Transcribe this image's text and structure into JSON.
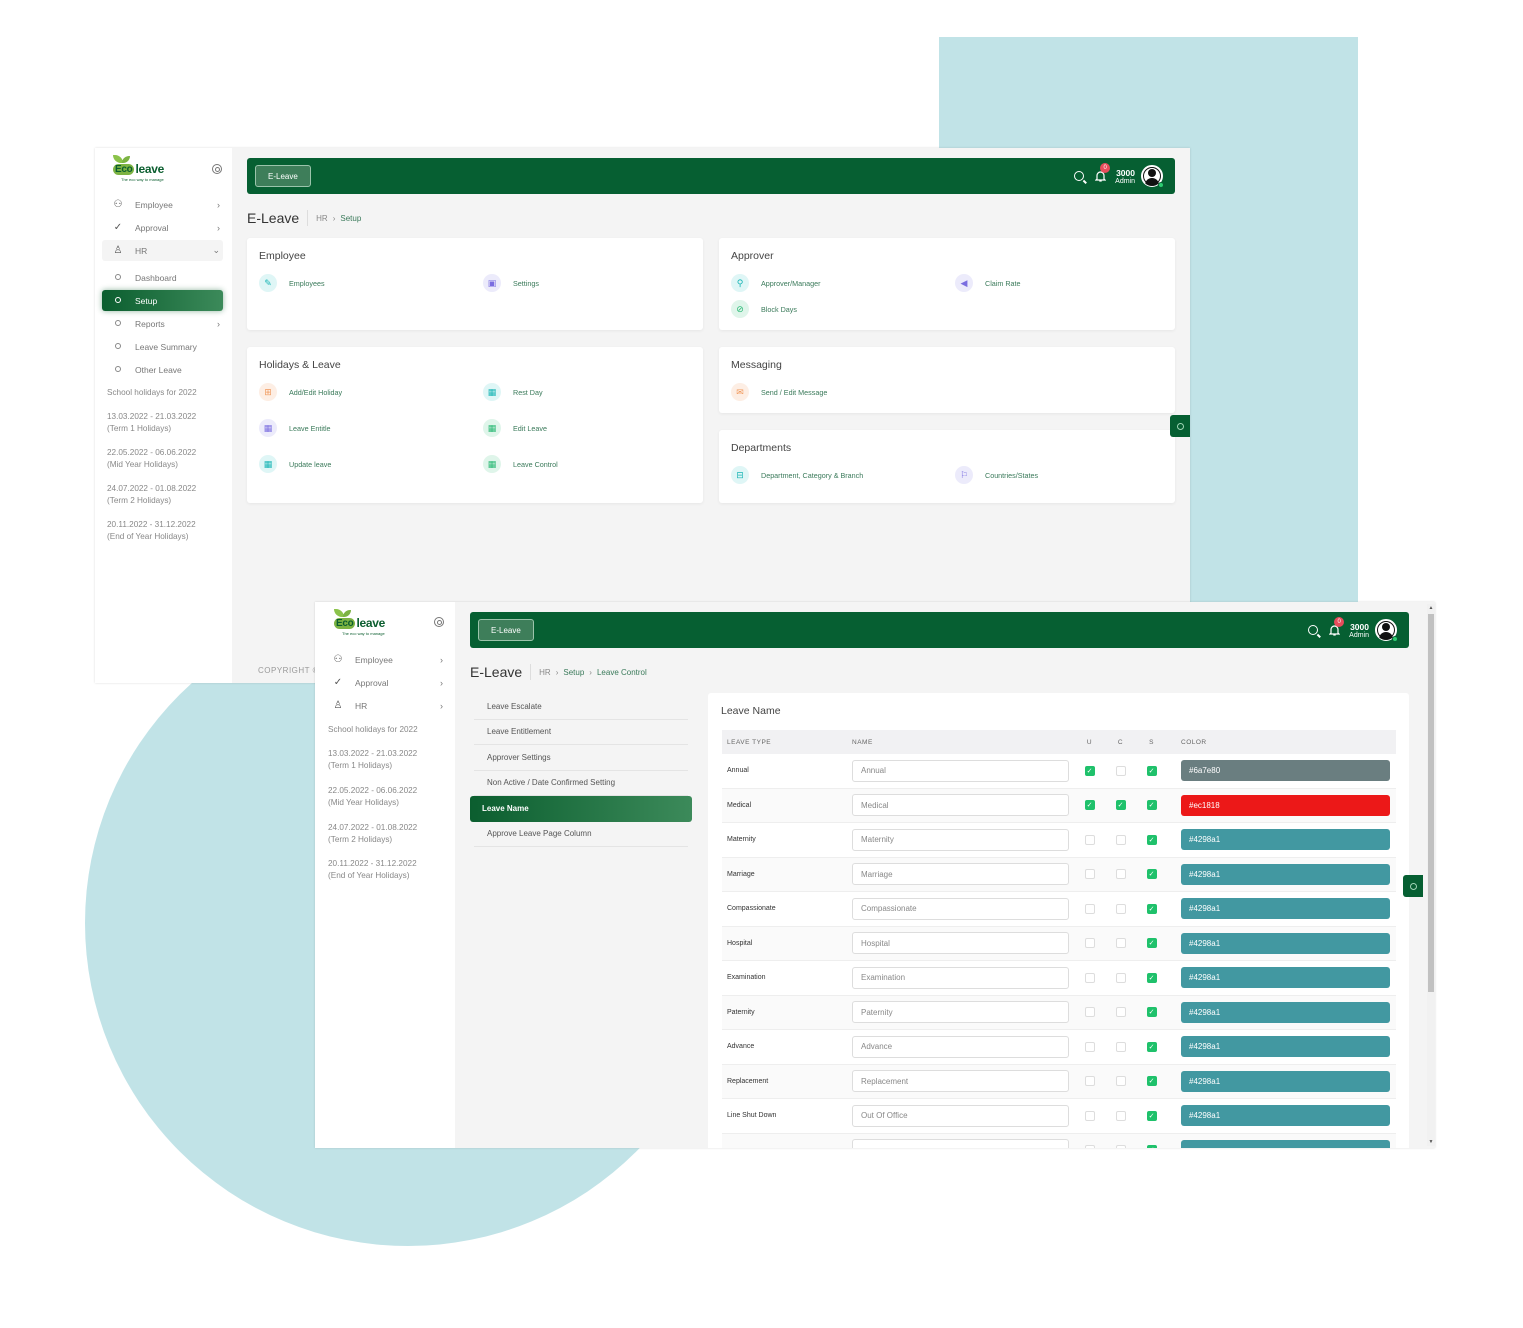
{
  "brand": {
    "logo_text_a": "Eco",
    "logo_text_b": "leave",
    "tagline": "The eco way to manage"
  },
  "colors": {
    "primary": "#065f32",
    "accent_bg": "#c1e3e7",
    "check_green": "#1fc16b"
  },
  "topbar": {
    "app_button": "E-Leave",
    "notification_count": "0",
    "user_number": "3000",
    "user_role": "Admin",
    "icons": [
      "search-icon",
      "bell-icon",
      "avatar"
    ]
  },
  "window1": {
    "sidebar": {
      "items": [
        {
          "label": "Employee",
          "icon": "users-icon",
          "chevron": "›"
        },
        {
          "label": "Approval",
          "icon": "check-icon",
          "chevron": "›"
        },
        {
          "label": "HR",
          "icon": "user-icon",
          "chevron": "⌄"
        }
      ],
      "sub_items": [
        {
          "label": "Dashboard"
        },
        {
          "label": "Setup"
        },
        {
          "label": "Reports",
          "chevron": "›"
        },
        {
          "label": "Leave Summary"
        },
        {
          "label": "Other Leave"
        }
      ],
      "holidays_title": "School holidays for 2022",
      "holidays": [
        {
          "dates": "13.03.2022 - 21.03.2022",
          "name": "(Term 1 Holidays)"
        },
        {
          "dates": "22.05.2022 - 06.06.2022",
          "name": "(Mid Year Holidays)"
        },
        {
          "dates": "24.07.2022 - 01.08.2022",
          "name": "(Term 2 Holidays)"
        },
        {
          "dates": "20.11.2022 - 31.12.2022",
          "name": "(End of Year Holidays)"
        }
      ]
    },
    "page_title": "E-Leave",
    "breadcrumb": [
      "HR",
      "Setup"
    ],
    "copyright": "COPYRIGHT ©",
    "cards": {
      "employee": {
        "title": "Employee",
        "links": [
          "Employees",
          "Settings"
        ]
      },
      "approver": {
        "title": "Approver",
        "links": [
          "Approver/Manager",
          "Claim Rate",
          "Block Days"
        ]
      },
      "holidays": {
        "title": "Holidays & Leave",
        "links": [
          "Add/Edit Holiday",
          "Rest Day",
          "Leave Entitle",
          "Edit Leave",
          "Update leave",
          "Leave Control"
        ]
      },
      "messaging": {
        "title": "Messaging",
        "links": [
          "Send / Edit Message"
        ]
      },
      "departments": {
        "title": "Departments",
        "links": [
          "Department, Category & Branch",
          "Countries/States"
        ]
      }
    }
  },
  "window2": {
    "sidebar": {
      "items": [
        {
          "label": "Employee",
          "chevron": "›"
        },
        {
          "label": "Approval",
          "chevron": "›"
        },
        {
          "label": "HR",
          "chevron": "›"
        }
      ]
    },
    "page_title": "E-Leave",
    "breadcrumb": [
      "HR",
      "Setup",
      "Leave Control"
    ],
    "menu": [
      {
        "label": "Leave Escalate",
        "active": false
      },
      {
        "label": "Leave Entitlement",
        "active": false
      },
      {
        "label": "Approver Settings",
        "active": false
      },
      {
        "label": "Non Active / Date Confirmed Setting",
        "active": false
      },
      {
        "label": "Leave Name",
        "active": true
      },
      {
        "label": "Approve Leave Page Column",
        "active": false
      }
    ],
    "table": {
      "title": "Leave Name",
      "headers": [
        "LEAVE TYPE",
        "NAME",
        "U",
        "C",
        "S",
        "COLOR"
      ],
      "rows": [
        {
          "type": "Annual",
          "name": "Annual",
          "u": true,
          "c": false,
          "s": true,
          "color": "#6a7e80"
        },
        {
          "type": "Medical",
          "name": "Medical",
          "u": true,
          "c": true,
          "s": true,
          "color": "#ec1818"
        },
        {
          "type": "Maternity",
          "name": "Maternity",
          "u": false,
          "c": false,
          "s": true,
          "color": "#4298a1"
        },
        {
          "type": "Marriage",
          "name": "Marriage",
          "u": false,
          "c": false,
          "s": true,
          "color": "#4298a1"
        },
        {
          "type": "Compassionate",
          "name": "Compassionate",
          "u": false,
          "c": false,
          "s": true,
          "color": "#4298a1"
        },
        {
          "type": "Hospital",
          "name": "Hospital",
          "u": false,
          "c": false,
          "s": true,
          "color": "#4298a1"
        },
        {
          "type": "Examination",
          "name": "Examination",
          "u": false,
          "c": false,
          "s": true,
          "color": "#4298a1"
        },
        {
          "type": "Paternity",
          "name": "Paternity",
          "u": false,
          "c": false,
          "s": true,
          "color": "#4298a1"
        },
        {
          "type": "Advance",
          "name": "Advance",
          "u": false,
          "c": false,
          "s": true,
          "color": "#4298a1"
        },
        {
          "type": "Replacement",
          "name": "Replacement",
          "u": false,
          "c": false,
          "s": true,
          "color": "#4298a1"
        },
        {
          "type": "Line Shut Down",
          "name": "Out Of Office",
          "u": false,
          "c": false,
          "s": true,
          "color": "#4298a1"
        },
        {
          "type": "",
          "name": "",
          "u": false,
          "c": false,
          "s": true,
          "color": "#4298a1"
        }
      ]
    }
  }
}
